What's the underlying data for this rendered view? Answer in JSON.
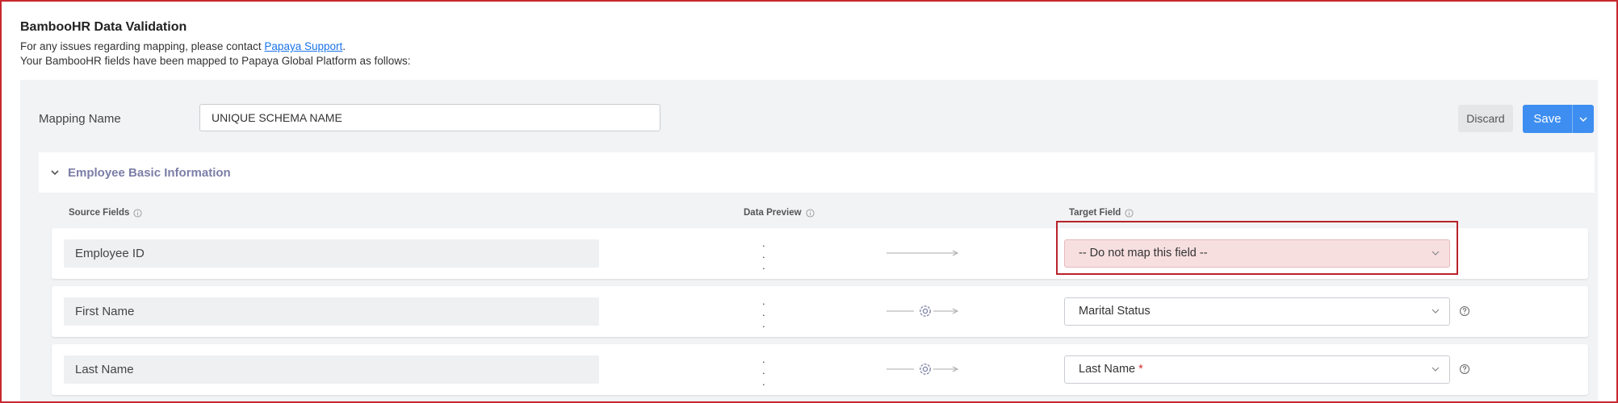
{
  "header": {
    "title": "BambooHR Data Validation",
    "contact_prefix": "For any issues regarding mapping, please contact ",
    "contact_link": "Papaya Support",
    "contact_suffix": ".",
    "description": "Your BambooHR fields have been mapped to Papaya Global Platform as follows:"
  },
  "mapping": {
    "label": "Mapping Name",
    "value": "UNIQUE SCHEMA NAME"
  },
  "actions": {
    "discard_label": "Discard",
    "save_label": "Save"
  },
  "section": {
    "title": "Employee Basic Information",
    "columns": {
      "source": "Source Fields",
      "preview": "Data Preview",
      "target": "Target Field"
    }
  },
  "rows": [
    {
      "source": "Employee ID",
      "preview": [
        ".",
        ".",
        "."
      ],
      "target": "-- Do not map this field --",
      "required": false,
      "has_config": false,
      "has_help": false,
      "error": true
    },
    {
      "source": "First Name",
      "preview": [
        ".",
        ".",
        "."
      ],
      "target": "Marital Status",
      "required": false,
      "has_config": true,
      "has_help": true,
      "error": false
    },
    {
      "source": "Last Name",
      "preview": [
        ".",
        ".",
        "."
      ],
      "target": "Last Name",
      "required": true,
      "has_config": true,
      "has_help": true,
      "error": false
    }
  ],
  "colors": {
    "accent": "#3d8ef0",
    "error_bg": "#f7dfe0",
    "highlight": "#b8232b",
    "section_title": "#7b7ea6"
  },
  "icons": {
    "info": "info-circle-icon",
    "config": "gear-icon",
    "arrow": "arrow-right-icon",
    "dropdown": "chevron-down-icon",
    "help": "question-circle-icon"
  }
}
